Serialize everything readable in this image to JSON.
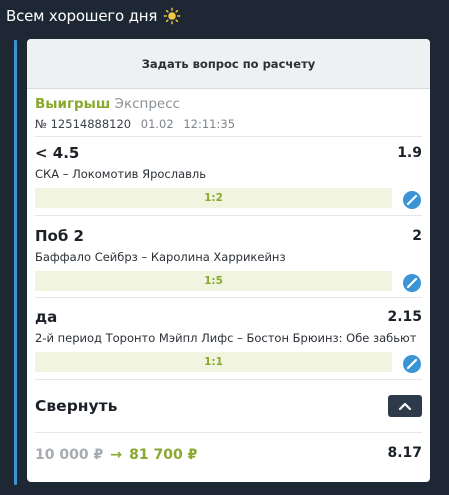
{
  "header": {
    "title": "Всем хорошего дня",
    "icon": "sun-icon"
  },
  "ask_button": {
    "label": "Задать вопрос по расчету"
  },
  "bet": {
    "status": "Выигрыш",
    "type": "Экспресс",
    "number": "№ 12514888120",
    "date": "01.02",
    "time": "12:11:35"
  },
  "selections": [
    {
      "name": "< 4.5",
      "odd": "1.9",
      "event": "СКА – Локомотив Ярославль",
      "score": "1:2",
      "icon": "chat-bubble-icon"
    },
    {
      "name": "Поб 2",
      "odd": "2",
      "event": "Баффало Сейбрз – Каролина Харрикейнз",
      "score": "1:5",
      "icon": "chat-bubble-icon"
    },
    {
      "name": "да",
      "odd": "2.15",
      "event": "2-й период Торонто Мэйпл Лифс – Бостон Брюинз: Обе забьют",
      "score": "1:1",
      "icon": "chat-bubble-icon"
    }
  ],
  "collapse": {
    "label": "Свернуть",
    "icon": "chevron-up-icon"
  },
  "totals": {
    "stake": "10 000 ₽",
    "arrow": "→",
    "payout": "81 700 ₽",
    "total_odd": "8.17"
  },
  "colors": {
    "background": "#1e2835",
    "accent": "#3a94d6",
    "win": "#8aa82e",
    "score_bar": "#f1f5df",
    "bubble": "#3a94d6"
  }
}
